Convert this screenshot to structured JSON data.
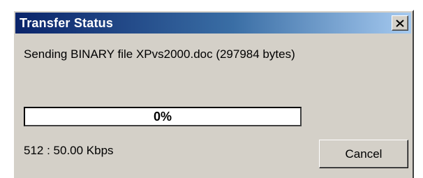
{
  "window": {
    "title": "Transfer Status",
    "close_icon": "close-icon"
  },
  "transfer": {
    "message": "Sending BINARY file XPvs2000.doc (297984 bytes)",
    "progress_label": "0%",
    "progress_fraction": 0.0,
    "speed_text": "512 : 50.00 Kbps"
  },
  "buttons": {
    "cancel_label": "Cancel"
  },
  "colors": {
    "title_gradient_start": "#0a246a",
    "title_gradient_end": "#a6caf0",
    "dialog_face": "#d4d0c8",
    "progress_fill": "#0a246a"
  }
}
